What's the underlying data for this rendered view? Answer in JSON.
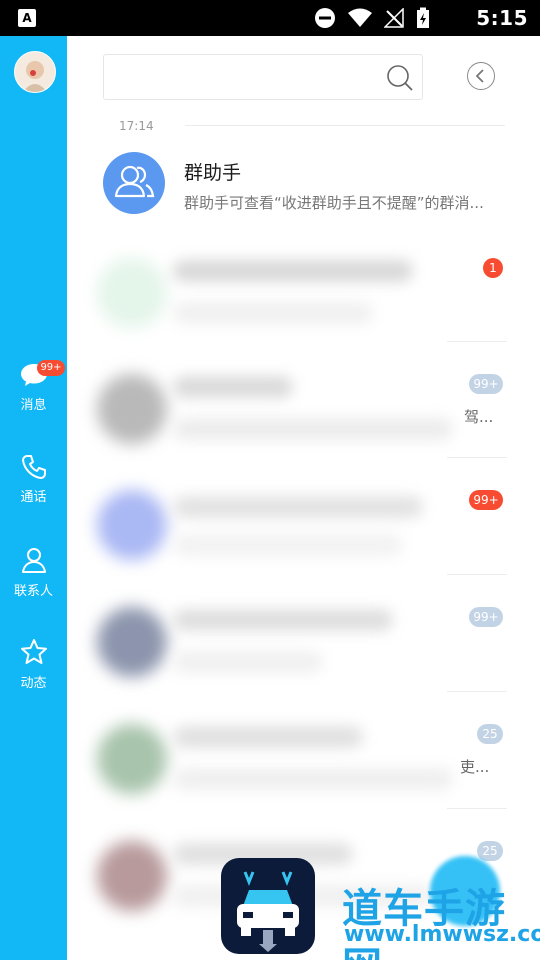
{
  "status_bar": {
    "time": "5:15",
    "left_icon": "A"
  },
  "sidebar": {
    "items": [
      {
        "label": "消息",
        "icon": "message-bubble-icon",
        "badge": "99+"
      },
      {
        "label": "通话",
        "icon": "phone-icon"
      },
      {
        "label": "联系人",
        "icon": "contact-person-icon"
      },
      {
        "label": "动态",
        "icon": "star-icon"
      }
    ]
  },
  "search": {
    "placeholder": ""
  },
  "conversations": {
    "section_time": "17:14",
    "group_helper": {
      "title": "群助手",
      "subtitle": "群助手可查看“收进群助手且不提醒”的群消..."
    },
    "rows": [
      {
        "badge": "1",
        "badge_color": "#f74c31",
        "fragment": ""
      },
      {
        "badge": "99+",
        "badge_color": "#c3d3e6",
        "fragment": "驾..."
      },
      {
        "badge": "99+",
        "badge_color": "#f74c31",
        "fragment": ""
      },
      {
        "badge": "99+",
        "badge_color": "#c3d3e6",
        "fragment": ""
      },
      {
        "badge": "25",
        "badge_color": "#c3d3e6",
        "fragment": "吏..."
      },
      {
        "badge": "25",
        "badge_color": "#c3d3e6",
        "fragment": ""
      }
    ]
  },
  "watermark": {
    "title": "道车手游网",
    "url": "www.lmwwsz.com"
  },
  "colors": {
    "sidebar": "#12b7f5",
    "badge_red": "#f74c31",
    "badge_muted": "#c3d3e6",
    "watermark": "#1ea3e6"
  }
}
